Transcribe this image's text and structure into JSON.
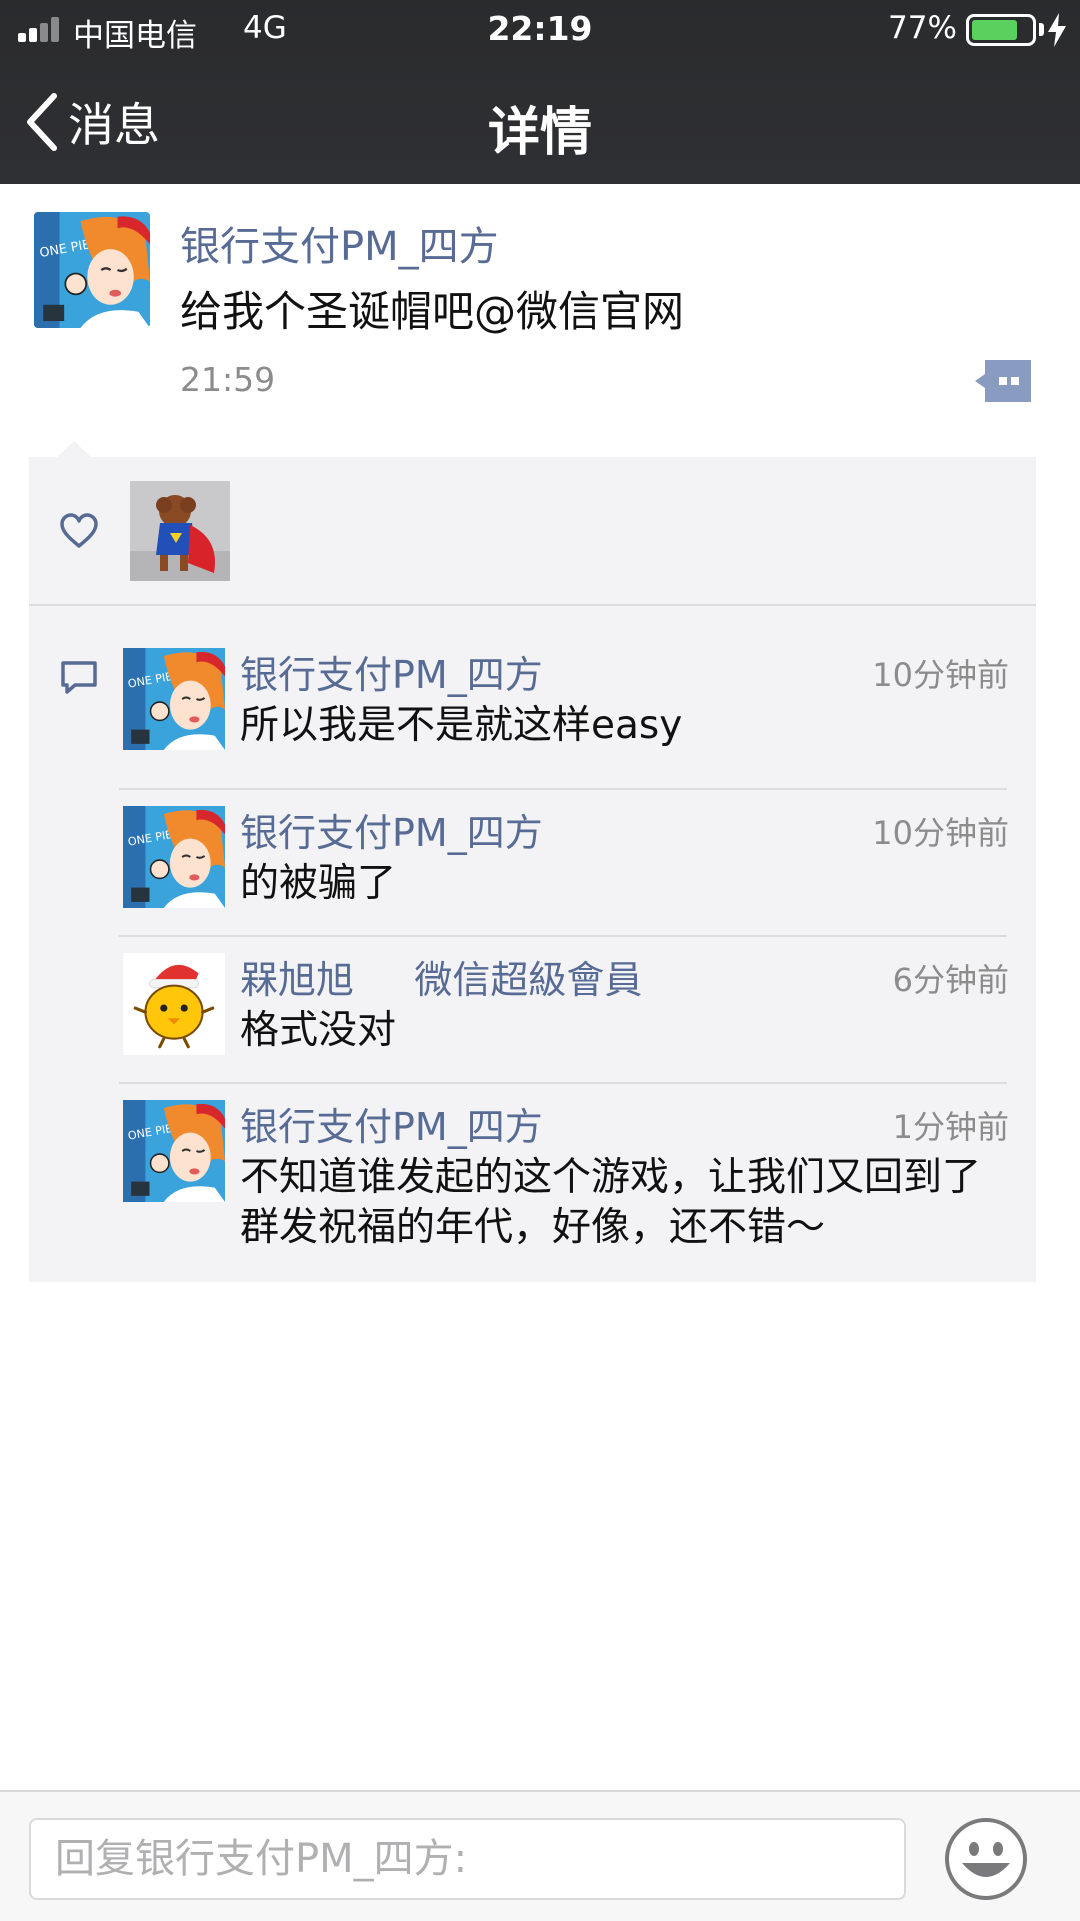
{
  "status_bar": {
    "carrier": "中国电信",
    "network": "4G",
    "time": "22:19",
    "battery_percent": "77%",
    "battery_level": 0.77,
    "battery_color": "#5ad15e"
  },
  "nav": {
    "back_label": "消息",
    "title": "详情"
  },
  "post": {
    "author": "银行支付PM_四方",
    "text": "给我个圣诞帽吧@微信官网",
    "time": "21:59"
  },
  "comments": [
    {
      "author": "银行支付PM_四方",
      "time": "10分钟前",
      "text": "所以我是不是就这样easy"
    },
    {
      "author": "银行支付PM_四方",
      "time": "10分钟前",
      "text": "的被骗了"
    },
    {
      "author": "槑旭旭     微信超級會員",
      "time": "6分钟前",
      "text": "格式没对"
    },
    {
      "author": "银行支付PM_四方",
      "time": "1分钟前",
      "text": "不知道谁发起的这个游戏，让我们又回到了群发祝福的年代，好像，还不错～"
    }
  ],
  "reply": {
    "placeholder": "回复银行支付PM_四方:"
  },
  "colors": {
    "name_link": "#576b95",
    "header_bg": "#2f3033",
    "box_bg": "#f3f3f5"
  },
  "icons": [
    "signal-icon",
    "battery-icon",
    "charging-icon",
    "back-chevron-icon",
    "comment-action-icon",
    "heart-icon",
    "comment-bubble-icon",
    "emoji-icon"
  ]
}
